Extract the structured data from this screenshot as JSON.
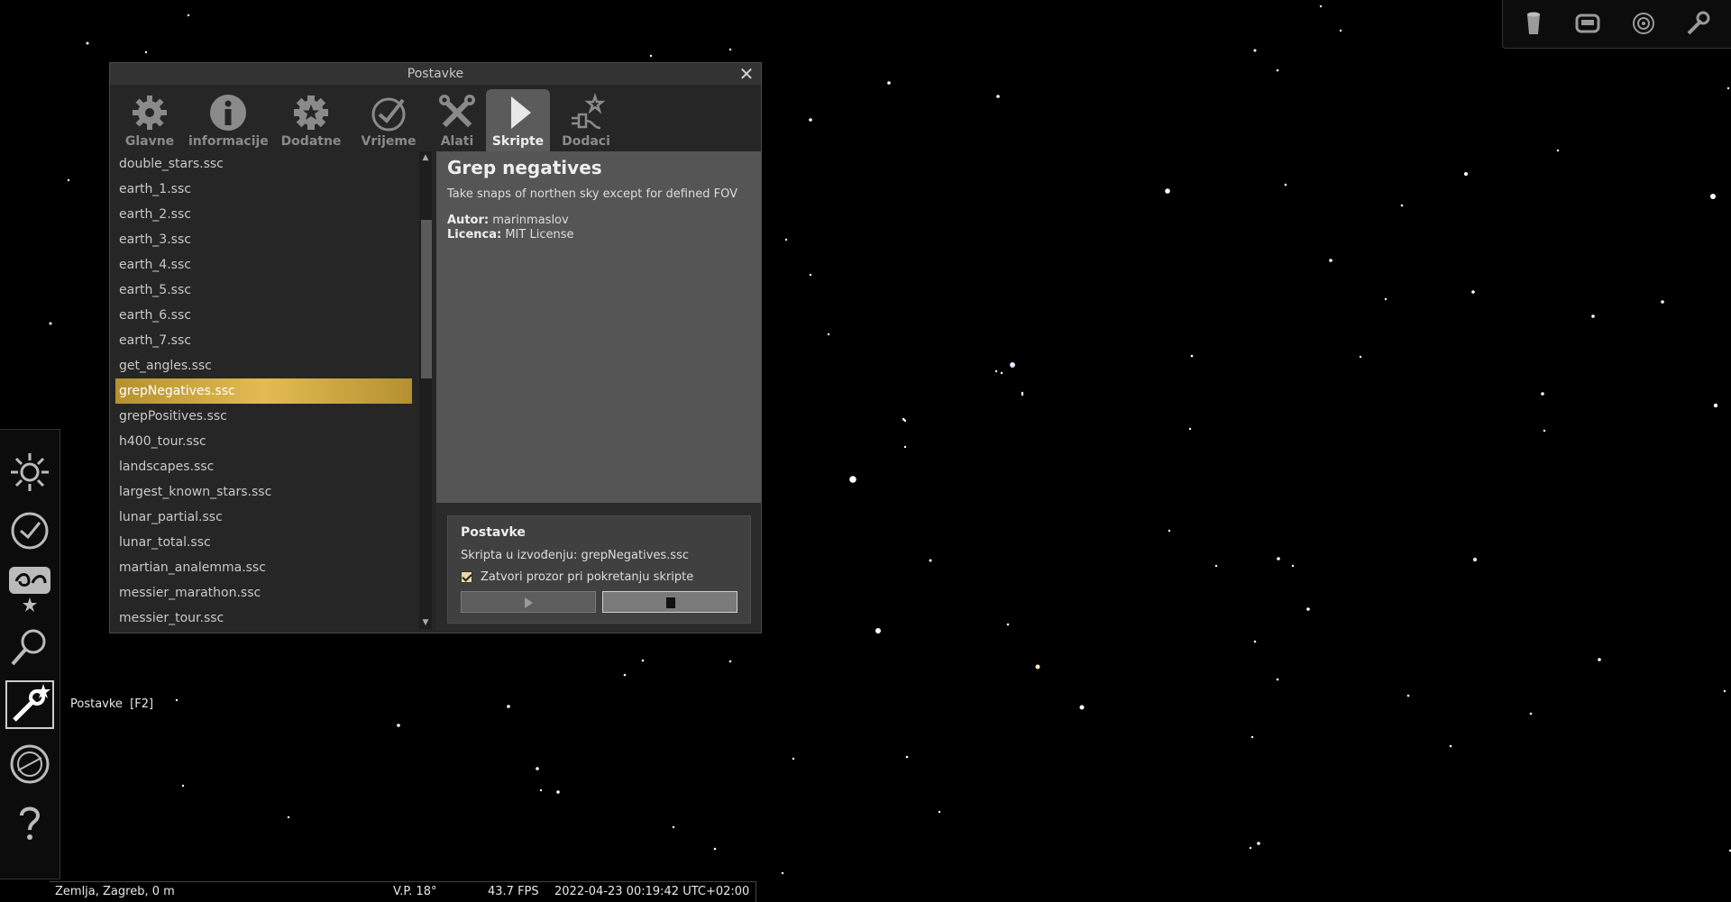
{
  "dialog": {
    "title": "Postavke",
    "close_symbol": "✕",
    "tabs": [
      {
        "label": "Glavne",
        "icon": "gear-icon",
        "active": false
      },
      {
        "label": "informacije",
        "icon": "info-icon",
        "active": false
      },
      {
        "label": "Dodatne",
        "icon": "gear-star-icon",
        "active": false
      },
      {
        "label": "Vrijeme",
        "icon": "clock-check-icon",
        "active": false
      },
      {
        "label": "Alati",
        "icon": "tools-icon",
        "active": false
      },
      {
        "label": "Skripte",
        "icon": "play-icon",
        "active": true
      },
      {
        "label": "Dodaci",
        "icon": "plugin-icon",
        "active": false
      }
    ],
    "scripts": [
      "double_stars.ssc",
      "earth_1.ssc",
      "earth_2.ssc",
      "earth_3.ssc",
      "earth_4.ssc",
      "earth_5.ssc",
      "earth_6.ssc",
      "earth_7.ssc",
      "get_angles.ssc",
      "grepNegatives.ssc",
      "grepPositives.ssc",
      "h400_tour.ssc",
      "landscapes.ssc",
      "largest_known_stars.ssc",
      "lunar_partial.ssc",
      "lunar_total.ssc",
      "martian_analemma.ssc",
      "messier_marathon.ssc",
      "messier_tour.ssc"
    ],
    "selected_script": "grepNegatives.ssc",
    "detail": {
      "title": "Grep negatives",
      "description": "Take snaps of northen sky except for defined FOV",
      "author_label": "Autor:",
      "author": "marinmaslov",
      "license_label": "Licenca:",
      "license": "MIT License"
    },
    "options": {
      "heading": "Postavke",
      "running_text": "Skripta u izvođenju: grepNegatives.ssc",
      "close_on_run_label": "Zatvori prozor pri pokretanju skripte",
      "close_on_run_checked": true
    }
  },
  "left_toolbar": {
    "buttons": [
      {
        "name": "sky-light-icon"
      },
      {
        "name": "time-icon"
      },
      {
        "name": "sky-culture-icon"
      },
      {
        "name": "search-icon"
      },
      {
        "name": "settings-icon",
        "active": true
      },
      {
        "name": "astrocalc-icon"
      },
      {
        "name": "help-icon"
      }
    ],
    "tooltip": "Postavke  [F2]"
  },
  "top_toolbar": {
    "buttons": [
      "bucket-icon",
      "fullscreen-icon",
      "target-icon",
      "wrench-icon"
    ]
  },
  "status": {
    "location": "Zemlja, Zagreb, 0 m",
    "fov": "V.P. 18°",
    "fps": "43.7 FPS",
    "datetime": "2022-04-23 00:19:42 UTC+02:00"
  },
  "colors": {
    "selection_gold": "#d4ae45",
    "dialog_bg": "#262626",
    "detail_bg": "#555555"
  }
}
